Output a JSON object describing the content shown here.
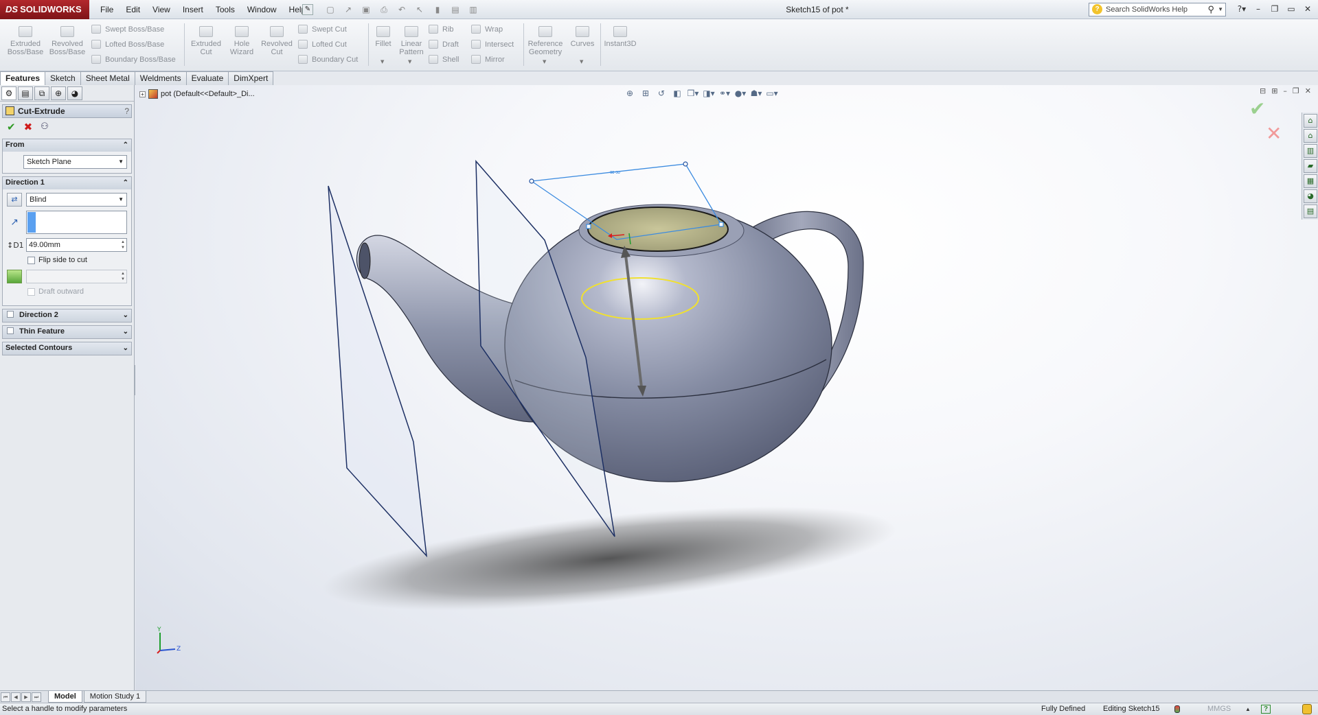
{
  "app": {
    "logo_text": "SOLIDWORKS",
    "document_title": "Sketch15 of pot *"
  },
  "menu": [
    "File",
    "Edit",
    "View",
    "Insert",
    "Tools",
    "Window",
    "Help"
  ],
  "help_search": {
    "placeholder": "Search SolidWorks Help"
  },
  "ribbon": {
    "extruded_boss": "Extruded\nBoss/Base",
    "revolved_boss": "Revolved\nBoss/Base",
    "swept_boss": "Swept Boss/Base",
    "lofted_boss": "Lofted Boss/Base",
    "boundary_boss": "Boundary Boss/Base",
    "extruded_cut": "Extruded\nCut",
    "hole_wizard": "Hole\nWizard",
    "revolved_cut": "Revolved\nCut",
    "swept_cut": "Swept Cut",
    "lofted_cut": "Lofted Cut",
    "boundary_cut": "Boundary Cut",
    "fillet": "Fillet",
    "linear_pattern": "Linear\nPattern",
    "rib": "Rib",
    "draft": "Draft",
    "shell": "Shell",
    "wrap": "Wrap",
    "intersect": "Intersect",
    "mirror": "Mirror",
    "reference_geometry": "Reference\nGeometry",
    "curves": "Curves",
    "instant3d": "Instant3D"
  },
  "tabs": [
    {
      "label": "Features",
      "active": true
    },
    {
      "label": "Sketch",
      "active": false
    },
    {
      "label": "Sheet Metal",
      "active": false
    },
    {
      "label": "Weldments",
      "active": false
    },
    {
      "label": "Evaluate",
      "active": false
    },
    {
      "label": "DimXpert",
      "active": false
    }
  ],
  "property_manager": {
    "title": "Cut-Extrude",
    "help": "?",
    "from": {
      "header": "From",
      "value": "Sketch Plane"
    },
    "direction1": {
      "header": "Direction 1",
      "end_condition": "Blind",
      "depth": "49.00mm",
      "flip_side_label": "Flip side to cut",
      "draft_outward_label": "Draft outward"
    },
    "direction2": {
      "header": "Direction 2"
    },
    "thin_feature": {
      "header": "Thin Feature"
    },
    "selected_contours": {
      "header": "Selected Contours"
    }
  },
  "tree": {
    "root_label": "pot  (Default<<Default>_Di..."
  },
  "triad": {
    "y": "Y",
    "z": "Z"
  },
  "bottom_tabs": [
    {
      "label": "Model",
      "active": true
    },
    {
      "label": "Motion Study 1",
      "active": false
    }
  ],
  "status": {
    "message": "Select a handle to modify parameters",
    "defined": "Fully Defined",
    "editing": "Editing Sketch15",
    "units": "MMGS"
  },
  "colors": {
    "model": "#8c93a8",
    "sketch_selection": "#3b8be0",
    "contour": "#f0e030",
    "plane_edge": "#1c2f63",
    "ok": "#2f9a24",
    "cancel": "#cf1b1b"
  }
}
